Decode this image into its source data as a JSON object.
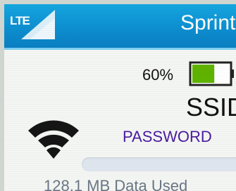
{
  "status_bar": {
    "network_type": "LTE",
    "carrier": "Sprint"
  },
  "battery": {
    "percent_label": "60%",
    "level": 0.6,
    "fill_color": "#5fb300"
  },
  "wifi": {
    "ssid_label": "SSID",
    "password_label": "PASSWORD",
    "icon": "wifi-icon"
  },
  "data_usage": {
    "used_label": "128.1 MB Data Used"
  },
  "colors": {
    "accent": "#0d8fd0",
    "password_text": "#4a1aa0"
  }
}
